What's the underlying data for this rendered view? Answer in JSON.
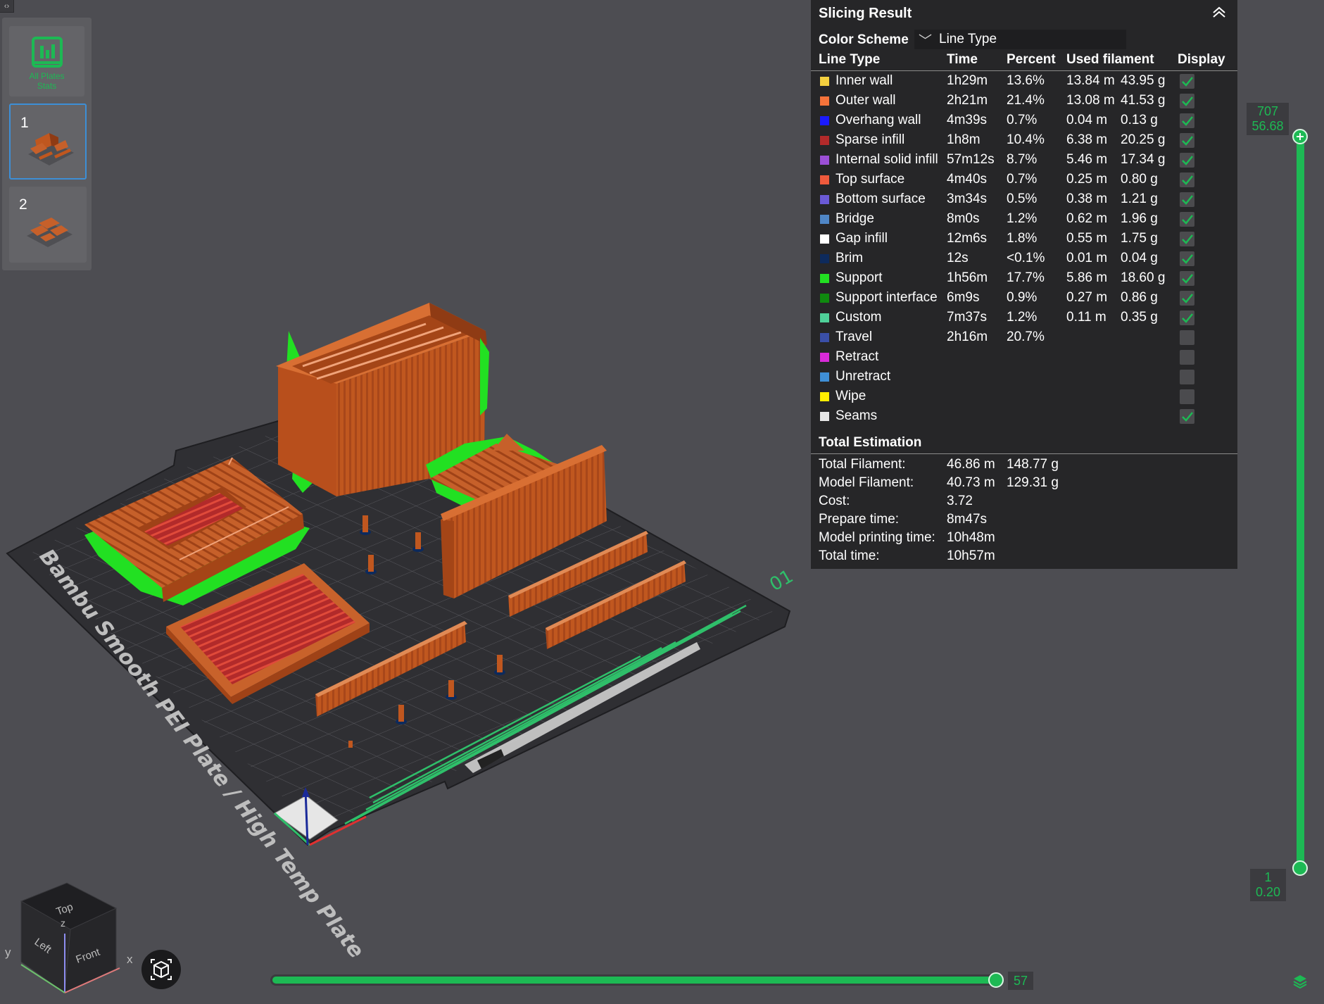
{
  "sidebar": {
    "all_plates_label_1": "All Plates",
    "all_plates_label_2": "Stats",
    "plates": [
      {
        "number": "1",
        "selected": true
      },
      {
        "number": "2",
        "selected": false
      }
    ]
  },
  "panel": {
    "title": "Slicing Result",
    "color_scheme_label": "Color Scheme",
    "color_scheme_value": "Line Type",
    "columns": [
      "Line Type",
      "Time",
      "Percent",
      "Used filament",
      "Display"
    ],
    "rows": [
      {
        "name": "Inner wall",
        "color": "#f4d03f",
        "time": "1h29m",
        "percent": "13.6%",
        "length": "13.84 m",
        "weight": "43.95 g",
        "display": true
      },
      {
        "name": "Outer wall",
        "color": "#f5733a",
        "time": "2h21m",
        "percent": "21.4%",
        "length": "13.08 m",
        "weight": "41.53 g",
        "display": true
      },
      {
        "name": "Overhang wall",
        "color": "#1a1aff",
        "time": "4m39s",
        "percent": "0.7%",
        "length": "0.04 m",
        "weight": "0.13 g",
        "display": true
      },
      {
        "name": "Sparse infill",
        "color": "#b22a2a",
        "time": "1h8m",
        "percent": "10.4%",
        "length": "6.38 m",
        "weight": "20.25 g",
        "display": true
      },
      {
        "name": "Internal solid infill",
        "color": "#9b4fd6",
        "time": "57m12s",
        "percent": "8.7%",
        "length": "5.46 m",
        "weight": "17.34 g",
        "display": true
      },
      {
        "name": "Top surface",
        "color": "#ef5a3c",
        "time": "4m40s",
        "percent": "0.7%",
        "length": "0.25 m",
        "weight": "0.80 g",
        "display": true
      },
      {
        "name": "Bottom surface",
        "color": "#6a5ad6",
        "time": "3m34s",
        "percent": "0.5%",
        "length": "0.38 m",
        "weight": "1.21 g",
        "display": true
      },
      {
        "name": "Bridge",
        "color": "#4f86c6",
        "time": "8m0s",
        "percent": "1.2%",
        "length": "0.62 m",
        "weight": "1.96 g",
        "display": true
      },
      {
        "name": "Gap infill",
        "color": "#ffffff",
        "time": "12m6s",
        "percent": "1.8%",
        "length": "0.55 m",
        "weight": "1.75 g",
        "display": true
      },
      {
        "name": "Brim",
        "color": "#0d2a5c",
        "time": "12s",
        "percent": "<0.1%",
        "length": "0.01 m",
        "weight": "0.04 g",
        "display": true
      },
      {
        "name": "Support",
        "color": "#22e022",
        "time": "1h56m",
        "percent": "17.7%",
        "length": "5.86 m",
        "weight": "18.60 g",
        "display": true
      },
      {
        "name": "Support interface",
        "color": "#0f8a0f",
        "time": "6m9s",
        "percent": "0.9%",
        "length": "0.27 m",
        "weight": "0.86 g",
        "display": true
      },
      {
        "name": "Custom",
        "color": "#4fd19a",
        "time": "7m37s",
        "percent": "1.2%",
        "length": "0.11 m",
        "weight": "0.35 g",
        "display": true
      },
      {
        "name": "Travel",
        "color": "#3a4fa8",
        "time": "2h16m",
        "percent": "20.7%",
        "length": "",
        "weight": "",
        "display": false
      },
      {
        "name": "Retract",
        "color": "#d92ad9",
        "time": "",
        "percent": "",
        "length": "",
        "weight": "",
        "display": false
      },
      {
        "name": "Unretract",
        "color": "#3f8fd6",
        "time": "",
        "percent": "",
        "length": "",
        "weight": "",
        "display": false
      },
      {
        "name": "Wipe",
        "color": "#ffee00",
        "time": "",
        "percent": "",
        "length": "",
        "weight": "",
        "display": false
      },
      {
        "name": "Seams",
        "color": "#e6e6e6",
        "time": "",
        "percent": "",
        "length": "",
        "weight": "",
        "display": true
      }
    ],
    "total_title": "Total Estimation",
    "totals": [
      {
        "label": "Total Filament:",
        "value1": "46.86 m",
        "value2": "148.77 g"
      },
      {
        "label": "Model Filament:",
        "value1": "40.73 m",
        "value2": "129.31 g"
      },
      {
        "label": "Cost:",
        "value1": "3.72",
        "value2": ""
      },
      {
        "label": "Prepare time:",
        "value1": "8m47s",
        "value2": ""
      },
      {
        "label": "Model printing time:",
        "value1": "10h48m",
        "value2": ""
      },
      {
        "label": "Total time:",
        "value1": "10h57m",
        "value2": ""
      }
    ]
  },
  "layer_slider": {
    "top_layer": "707",
    "top_height": "56.68",
    "bottom_layer": "1",
    "bottom_height": "0.20"
  },
  "move_slider": {
    "value": "57"
  },
  "plate_text": "Bambu Smooth PEI Plate / High Temp Plate",
  "plate_number": "01",
  "nav_cube": {
    "top": "Top",
    "left": "Left",
    "front": "Front",
    "x": "x",
    "y": "y",
    "z": "z"
  },
  "colors": {
    "accent": "#1db954",
    "model": "#c0571f",
    "support": "#22e022",
    "infill": "#b22a2a",
    "panel_bg": "#262628",
    "viewport_bg": "#4d4d52"
  }
}
